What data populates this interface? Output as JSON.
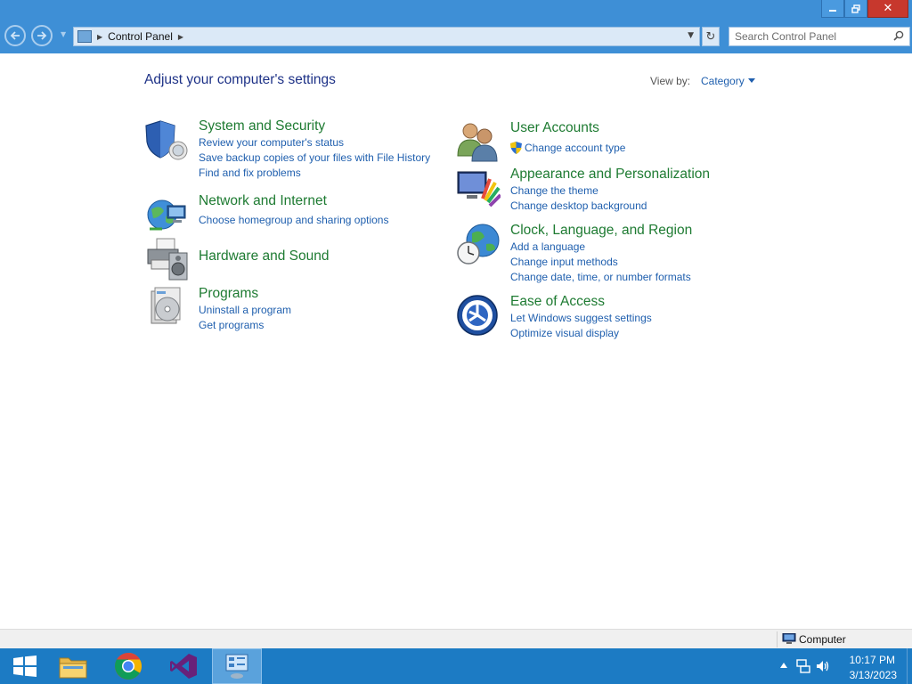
{
  "window": {
    "minimize_icon": "minimize-icon",
    "restore_icon": "restore-icon",
    "close_label": "✕"
  },
  "nav": {
    "back_icon": "back-arrow-icon",
    "forward_icon": "forward-arrow-icon",
    "breadcrumb": "Control Panel",
    "search_placeholder": "Search Control Panel",
    "search_value": ""
  },
  "main": {
    "heading": "Adjust your computer's settings",
    "view_by_label": "View by:",
    "view_by_value": "Category",
    "categories": [
      {
        "title": "System and Security",
        "icon": "shield-icon",
        "links": [
          "Review your computer's status",
          "Save backup copies of your files with File History",
          "Find and fix problems"
        ]
      },
      {
        "title": "Network and Internet",
        "icon": "network-globe-icon",
        "links": [
          "Choose homegroup and sharing options"
        ]
      },
      {
        "title": "Hardware and Sound",
        "icon": "printer-speaker-icon",
        "links": []
      },
      {
        "title": "Programs",
        "icon": "programs-disc-icon",
        "links": [
          "Uninstall a program",
          "Get programs"
        ]
      },
      {
        "title": "User Accounts",
        "icon": "users-icon",
        "links": [
          "Change account type"
        ]
      },
      {
        "title": "Appearance and Personalization",
        "icon": "monitor-palette-icon",
        "links": [
          "Change the theme",
          "Change desktop background"
        ]
      },
      {
        "title": "Clock, Language, and Region",
        "icon": "clock-globe-icon",
        "links": [
          "Add a language",
          "Change input methods",
          "Change date, time, or number formats"
        ]
      },
      {
        "title": "Ease of Access",
        "icon": "ease-of-access-icon",
        "links": [
          "Let Windows suggest settings",
          "Optimize visual display"
        ]
      }
    ]
  },
  "status_bar": {
    "location": "Computer"
  },
  "taskbar": {
    "items": [
      "windows-start-icon",
      "file-explorer-icon",
      "chrome-icon",
      "visual-studio-icon",
      "control-panel-icon"
    ],
    "time": "10:17 PM",
    "date": "3/13/2023"
  },
  "colors": {
    "accent": "#3e8fd6",
    "taskbar": "#1c7bc4",
    "category_title": "#1e7b32",
    "link": "#1f5fae",
    "heading": "#1e3287"
  }
}
